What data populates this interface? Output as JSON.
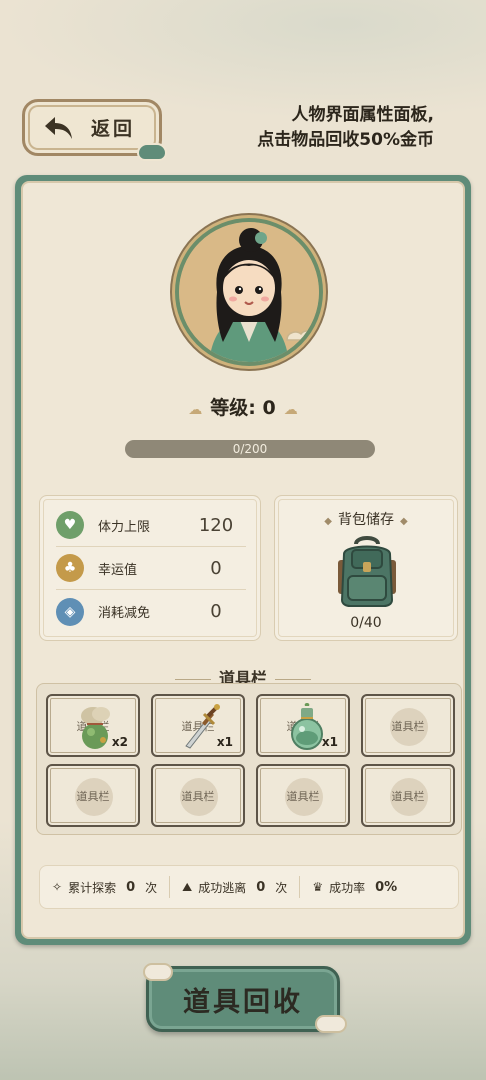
{
  "header": {
    "back_label": "返回",
    "hint_line1": "人物界面属性面板,",
    "hint_line2": "点击物品回收50%金币"
  },
  "character": {
    "level_label": "等级: 0",
    "xp_text": "0/200",
    "xp_current": 0,
    "xp_max": 200
  },
  "stats": [
    {
      "label": "体力上限",
      "value": "120",
      "icon": "heart-icon",
      "color": "#6f9f6a"
    },
    {
      "label": "幸运值",
      "value": "0",
      "icon": "clover-icon",
      "color": "#c49a4a"
    },
    {
      "label": "消耗减免",
      "value": "0",
      "icon": "shield-icon",
      "color": "#5f8fb5"
    }
  ],
  "backpack": {
    "title": "背包储存",
    "count": "0/40"
  },
  "items": {
    "title": "道具栏",
    "slots": [
      {
        "label": "道具栏",
        "icon": "herb-bundle-icon",
        "qty": "x2"
      },
      {
        "label": "道具栏",
        "icon": "dagger-icon",
        "qty": "x1"
      },
      {
        "label": "道具栏",
        "icon": "potion-icon",
        "qty": "x1"
      },
      {
        "label": "道具栏",
        "icon": "",
        "qty": ""
      },
      {
        "label": "道具栏",
        "icon": "",
        "qty": ""
      },
      {
        "label": "道具栏",
        "icon": "",
        "qty": ""
      },
      {
        "label": "道具栏",
        "icon": "",
        "qty": ""
      },
      {
        "label": "道具栏",
        "icon": "",
        "qty": ""
      }
    ]
  },
  "summary": {
    "explore_label": "累计探索",
    "explore_value": "0",
    "explore_unit": "次",
    "escape_label": "成功逃离",
    "escape_value": "0",
    "escape_unit": "次",
    "rate_label": "成功率",
    "rate_value": "0%"
  },
  "recycle_label": "道具回收",
  "colors": {
    "accent_green": "#5f8c79",
    "parchment": "#efe7d6",
    "wood": "#a18764"
  }
}
